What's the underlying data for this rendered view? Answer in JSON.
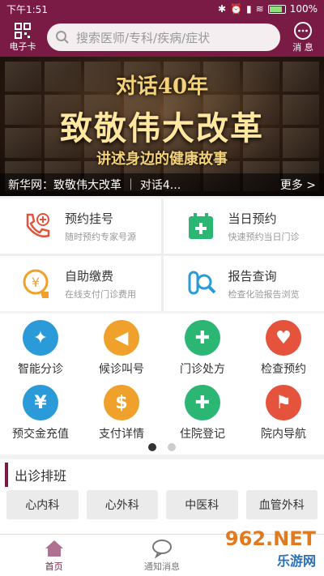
{
  "status_bar": {
    "time": "下午1:51",
    "battery": "100%"
  },
  "top_bar": {
    "ecard_label": "电子卡",
    "search_placeholder": "搜索医师/专科/疾病/症状",
    "message_label": "消 息"
  },
  "banner": {
    "line1": "对话40年",
    "line2": "致敬伟大改革",
    "line3": "讲述身边的健康故事",
    "caption": "新华网：致敬伟大改革 ｜ 对话4...",
    "more": "更多 >"
  },
  "quick_services": [
    {
      "title": "预约挂号",
      "sub": "随时预约专家号源",
      "color": "#e5533c",
      "icon": "phone-plus-icon"
    },
    {
      "title": "当日预约",
      "sub": "快速预约当日门诊",
      "color": "#2bb673",
      "icon": "calendar-plus-icon"
    },
    {
      "title": "自助缴费",
      "sub": "在线支付门诊费用",
      "color": "#f0a12c",
      "icon": "yuan-coin-icon"
    },
    {
      "title": "报告查询",
      "sub": "检查化验报告浏览",
      "color": "#2a9ad8",
      "icon": "report-search-icon"
    }
  ],
  "grid_row1": [
    {
      "label": "智能分诊",
      "color": "#2a9ad8",
      "icon": "triage-arrows-icon",
      "glyph": "✦"
    },
    {
      "label": "候诊叫号",
      "color": "#f0a12c",
      "icon": "speaker-icon",
      "glyph": "◀"
    },
    {
      "label": "门诊处方",
      "color": "#2bb673",
      "icon": "prescription-icon",
      "glyph": "✚"
    },
    {
      "label": "检查预约",
      "color": "#e5533c",
      "icon": "checkup-icon",
      "glyph": "♥"
    }
  ],
  "grid_row2": [
    {
      "label": "预交金充值",
      "color": "#2a9ad8",
      "icon": "yuan-icon",
      "glyph": "¥"
    },
    {
      "label": "支付详情",
      "color": "#f0a12c",
      "icon": "money-bag-icon",
      "glyph": "$"
    },
    {
      "label": "住院登记",
      "color": "#2bb673",
      "icon": "hospital-register-icon",
      "glyph": "✚"
    },
    {
      "label": "院内导航",
      "color": "#e5533c",
      "icon": "map-pin-icon",
      "glyph": "⚑"
    }
  ],
  "schedule": {
    "title": "出诊排班",
    "departments": [
      "心内科",
      "心外科",
      "中医科",
      "血管外科"
    ]
  },
  "tab_bar": {
    "home": "首页",
    "notices": "通知消息"
  },
  "watermark": {
    "line1": "962.NET",
    "line2": "乐游网"
  }
}
